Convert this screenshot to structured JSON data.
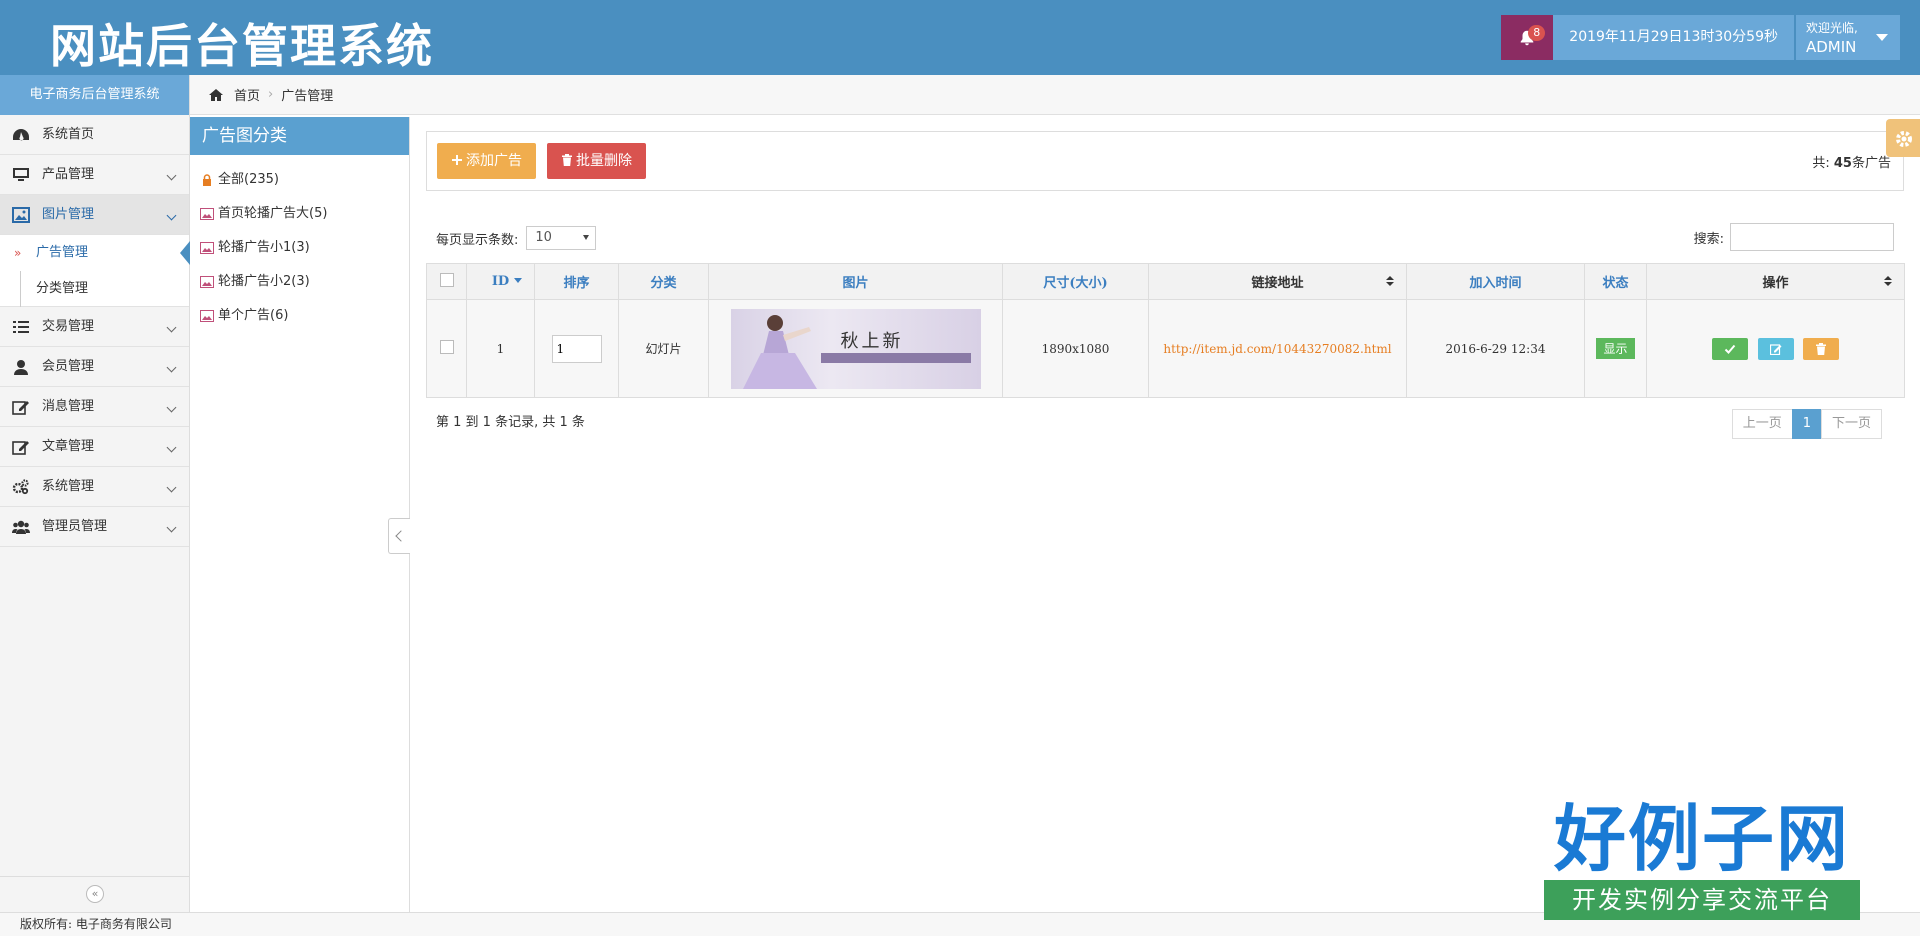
{
  "header": {
    "brand": "网站后台管理系统",
    "notification_count": "8",
    "datetime": "2019年11月29日13时30分59秒",
    "welcome": "欢迎光临,",
    "username": "ADMIN"
  },
  "sidebar": {
    "title": "电子商务后台管理系统",
    "items": [
      {
        "label": "系统首页",
        "icon": "dashboard-icon"
      },
      {
        "label": "产品管理",
        "icon": "monitor-icon"
      },
      {
        "label": "图片管理",
        "icon": "picture-icon",
        "active": true
      },
      {
        "label": "交易管理",
        "icon": "list-icon"
      },
      {
        "label": "会员管理",
        "icon": "user-icon"
      },
      {
        "label": "消息管理",
        "icon": "edit-icon"
      },
      {
        "label": "文章管理",
        "icon": "edit-icon"
      },
      {
        "label": "系统管理",
        "icon": "gears-icon"
      },
      {
        "label": "管理员管理",
        "icon": "users-icon"
      }
    ],
    "sub_items": [
      {
        "label": "广告管理",
        "active": true,
        "marker": "»"
      },
      {
        "label": "分类管理"
      }
    ],
    "collapse_glyph": "«"
  },
  "breadcrumb": {
    "home": "首页",
    "separator": "›",
    "current": "广告管理"
  },
  "categories": {
    "title": "广告图分类",
    "items": [
      {
        "label": "全部(235)",
        "icon": "lock-icon"
      },
      {
        "label": "首页轮播广告大(5)",
        "icon": "image-icon"
      },
      {
        "label": "轮播广告小1(3)",
        "icon": "image-icon"
      },
      {
        "label": "轮播广告小2(3)",
        "icon": "image-icon"
      },
      {
        "label": "单个广告(6)",
        "icon": "image-icon"
      }
    ]
  },
  "toolbar": {
    "add_label": "添加广告",
    "delete_label": "批量删除",
    "total_prefix": "共:",
    "total_count": "45",
    "total_suffix": "条广告"
  },
  "controls": {
    "page_size_label": "每页显示条数:",
    "page_size_value": "10",
    "search_label": "搜索:",
    "search_value": ""
  },
  "table": {
    "headers": [
      "ID",
      "排序",
      "分类",
      "图片",
      "尺寸(大小)",
      "链接地址",
      "加入时间",
      "状态",
      "操作"
    ],
    "rows": [
      {
        "id": "1",
        "order": "1",
        "category": "幻灯片",
        "image_text": "秋上新",
        "size": "1890x1080",
        "link": "http://item.jd.com/10443270082.html",
        "added": "2016-6-29 12:34",
        "status": "显示"
      }
    ]
  },
  "footer_info": "第 1 到 1 条记录, 共 1 条",
  "pager": {
    "prev": "上一页",
    "current": "1",
    "next": "下一页"
  },
  "copyright": "版权所有: 电子商务有限公司",
  "watermark": {
    "big": "好例子网",
    "small": "开发实例分享交流平台"
  }
}
